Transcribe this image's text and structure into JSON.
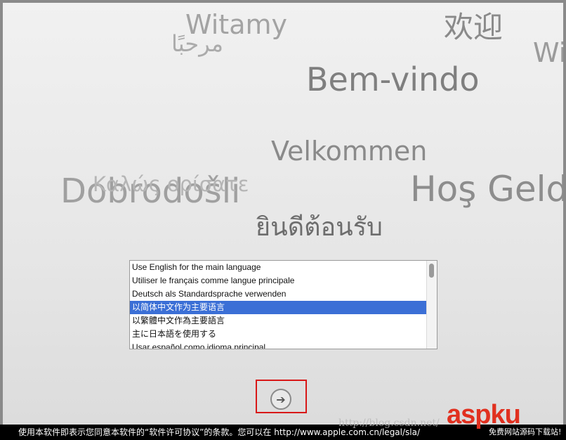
{
  "greetings": {
    "witamy": "Witamy",
    "marhaban": "مرحبًا",
    "huanying": "欢迎",
    "wi": "Wi",
    "bemvindo": "Bem-vindo",
    "velkommen": "Velkommen",
    "dobrodosli": "Dobrodošli",
    "kalos": "Καλώς ορίσατε",
    "hos_geldi": "Hoş Geldi",
    "thai": "ยินดีต้อนรับ"
  },
  "language_list": {
    "items": [
      {
        "label": "Use English for the main language",
        "selected": false
      },
      {
        "label": "Utiliser le français comme langue principale",
        "selected": false
      },
      {
        "label": "Deutsch als Standardsprache verwenden",
        "selected": false
      },
      {
        "label": "以简体中文作为主要语言",
        "selected": true
      },
      {
        "label": "以繁體中文作為主要語言",
        "selected": false
      },
      {
        "label": "主に日本語を使用する",
        "selected": false
      },
      {
        "label": "Usar español como idioma principal",
        "selected": false
      }
    ]
  },
  "next_button": {
    "icon": "arrow-right-icon",
    "glyph": "➔"
  },
  "footer": {
    "text": "使用本软件即表示您同意本软件的“软件许可协议”的条款。您可以在 http://www.apple.com.cn/legal/sla/"
  },
  "watermark": {
    "url": "http://blog.csdn.net/",
    "brand": "aspku",
    "brand_sub": "免费网站源码下载站!"
  },
  "colors": {
    "selection": "#3b6fd6",
    "highlight_frame": "#d81818",
    "brand": "#e1301f"
  }
}
